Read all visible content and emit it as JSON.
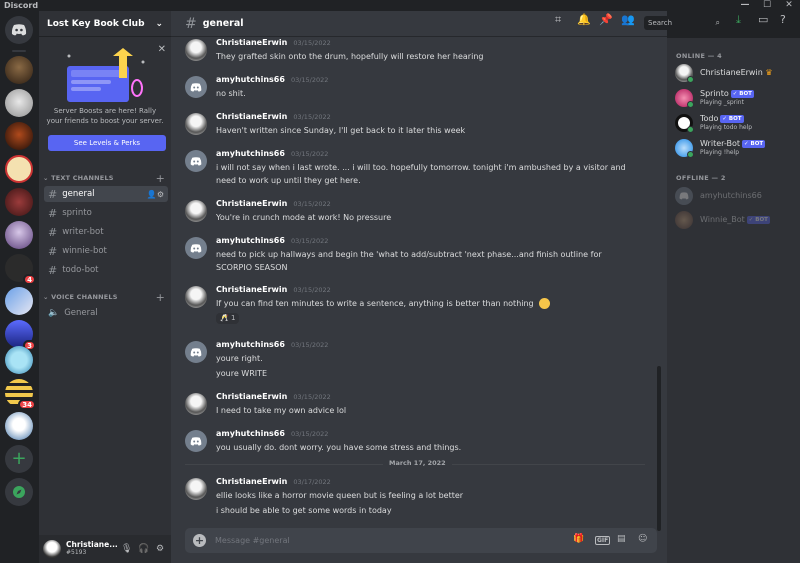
{
  "window": {
    "app_title": "Discord",
    "controls": [
      "—",
      "☐",
      "✕"
    ]
  },
  "server": {
    "name": "Lost Key Book Club",
    "boost_text": "Server Boosts are here! Rally your friends to boost your server.",
    "boost_button": "See Levels & Perks"
  },
  "server_rail": {
    "badges": [
      "4",
      "3",
      "34"
    ]
  },
  "categories": {
    "text": "TEXT CHANNELS",
    "voice": "VOICE CHANNELS"
  },
  "text_channels": [
    "general",
    "sprinto",
    "writer-bot",
    "winnie-bot",
    "todo-bot"
  ],
  "voice_channels": [
    "General"
  ],
  "user": {
    "name": "Christiane...",
    "tag": "#5193"
  },
  "channel": {
    "name": "general"
  },
  "search": {
    "placeholder": "Search"
  },
  "messages": [
    {
      "author": "ChristianeErwin",
      "time": "03/15/2022",
      "lines": [
        "They grafted skin onto the drum, hopefully will restore her hearing"
      ]
    },
    {
      "author": "amyhutchins66",
      "time": "03/15/2022",
      "lines": [
        "no shit."
      ]
    },
    {
      "author": "ChristianeErwin",
      "time": "03/15/2022",
      "lines": [
        "Haven't written since Sunday, I'll get back to it later this week"
      ]
    },
    {
      "author": "amyhutchins66",
      "time": "03/15/2022",
      "lines": [
        "i will not say when i last wrote. ... i will too. hopefully tomorrow. tonight i'm ambushed by a visitor and need to work up until they get here."
      ]
    },
    {
      "author": "ChristianeErwin",
      "time": "03/15/2022",
      "lines": [
        "You're in crunch mode at work! No pressure"
      ]
    },
    {
      "author": "amyhutchins66",
      "time": "03/15/2022",
      "lines": [
        "need to pick up hallways and begin the 'what to add/subtract 'next phase...and finish outline for SCORPIO SEASON"
      ]
    },
    {
      "author": "ChristianeErwin",
      "time": "03/15/2022",
      "lines": [
        "If you can find ten minutes to write a sentence, anything is better than nothing"
      ],
      "reaction": "1"
    },
    {
      "author": "amyhutchins66",
      "time": "03/15/2022",
      "lines": [
        "youre right.",
        "youre WRITE"
      ]
    },
    {
      "author": "ChristianeErwin",
      "time": "03/15/2022",
      "lines": [
        "I need to take my own advice lol"
      ]
    },
    {
      "author": "amyhutchins66",
      "time": "03/15/2022",
      "lines": [
        "you usually do. dont worry. you have some stress and things."
      ]
    },
    {
      "author": "ChristianeErwin",
      "time": "03/17/2022",
      "lines": [
        "ellie looks like a horror movie queen but is feeling a lot better",
        "i should be able to get some words in today"
      ]
    }
  ],
  "date_divider": "March 17, 2022",
  "composer": {
    "placeholder": "Message #general",
    "gif_label": "GIF"
  },
  "members": {
    "online_header": "ONLINE — 4",
    "offline_header": "OFFLINE — 2",
    "online": [
      {
        "name": "ChristianeErwin",
        "activity": "",
        "bot": false
      },
      {
        "name": "Sprinto",
        "activity": "Playing _sprint",
        "bot": true
      },
      {
        "name": "Todo",
        "activity": "Playing todo help",
        "bot": true
      },
      {
        "name": "Writer-Bot",
        "activity": "Playing !help",
        "bot": true
      }
    ],
    "offline": [
      {
        "name": "amyhutchins66",
        "bot": false
      },
      {
        "name": "Winnie_Bot",
        "bot": true
      }
    ],
    "bot_label": "✓ BOT"
  },
  "colors": {
    "blurple": "#5865f2",
    "online": "#3ba55d",
    "danger": "#ed4245"
  }
}
